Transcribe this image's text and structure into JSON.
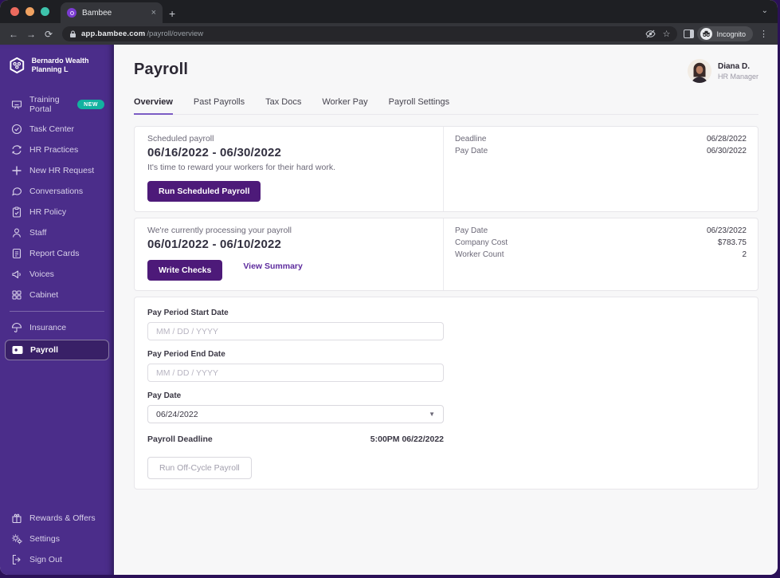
{
  "browser": {
    "tab_title": "Bambee",
    "url_host": "app.bambee.com",
    "url_path": "/payroll/overview",
    "incognito_label": "Incognito"
  },
  "colors": {
    "sidebar_purple": "#4b2d8a",
    "button_purple": "#4d1a79",
    "badge_teal": "#12b2a0",
    "link_purple": "#5e2c9e",
    "tab_underline": "#7c5cc4"
  },
  "sidebar": {
    "company_name": "Bernardo Wealth Planning L",
    "items": [
      {
        "label": "Training Portal",
        "badge": "NEW"
      },
      {
        "label": "Task Center"
      },
      {
        "label": "HR Practices"
      },
      {
        "label": "New HR Request"
      },
      {
        "label": "Conversations"
      },
      {
        "label": "HR Policy"
      },
      {
        "label": "Staff"
      },
      {
        "label": "Report Cards"
      },
      {
        "label": "Voices"
      },
      {
        "label": "Cabinet"
      }
    ],
    "items_secondary": [
      {
        "label": "Insurance"
      },
      {
        "label": "Payroll"
      }
    ],
    "items_bottom": [
      {
        "label": "Rewards & Offers"
      },
      {
        "label": "Settings"
      },
      {
        "label": "Sign Out"
      }
    ]
  },
  "header": {
    "title": "Payroll",
    "user_name": "Diana D.",
    "user_role": "HR Manager"
  },
  "tabs": [
    {
      "label": "Overview"
    },
    {
      "label": "Past Payrolls"
    },
    {
      "label": "Tax Docs"
    },
    {
      "label": "Worker Pay"
    },
    {
      "label": "Payroll Settings"
    }
  ],
  "scheduled_card": {
    "label": "Scheduled payroll",
    "period": "06/16/2022 - 06/30/2022",
    "description": "It's time to reward your workers for their hard work.",
    "button": "Run Scheduled Payroll",
    "details": [
      [
        "Deadline",
        "06/28/2022"
      ],
      [
        "Pay Date",
        "06/30/2022"
      ]
    ]
  },
  "processing_card": {
    "label": "We're currently processing your payroll",
    "period": "06/01/2022 - 06/10/2022",
    "primary_button": "Write Checks",
    "link": "View Summary",
    "details": [
      [
        "Pay Date",
        "06/23/2022"
      ],
      [
        "Company Cost",
        "$783.75"
      ],
      [
        "Worker Count",
        "2"
      ]
    ]
  },
  "offcycle_card": {
    "start_label": "Pay Period Start Date",
    "start_placeholder": "MM / DD / YYYY",
    "end_label": "Pay Period End Date",
    "end_placeholder": "MM / DD / YYYY",
    "pay_date_label": "Pay Date",
    "pay_date_value": "06/24/2022",
    "deadline_label": "Payroll Deadline",
    "deadline_value": "5:00PM 06/22/2022",
    "button": "Run Off-Cycle Payroll"
  }
}
